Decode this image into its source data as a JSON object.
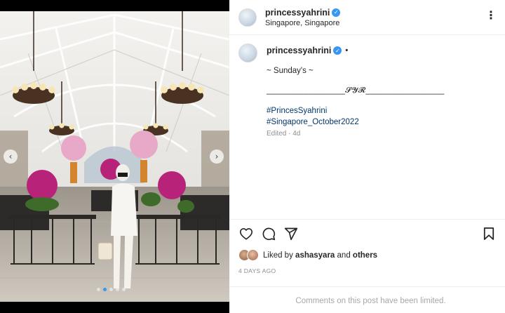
{
  "post": {
    "username": "princessyahrini",
    "location": "Singapore, Singapore",
    "more_icon": "more-horizontal-icon",
    "caption": {
      "line1": "~ Sunday's ~",
      "line2": "_________________𝓢𝓨𝓡_________________",
      "hashtags": [
        "#PrincesSyahrini",
        "#Singapore_October2022"
      ],
      "edited": "Edited · 4d"
    },
    "actions": {
      "like_icon": "heart-icon",
      "comment_icon": "comment-icon",
      "share_icon": "share-icon",
      "save_icon": "bookmark-icon"
    },
    "likes": {
      "prefix": "Liked by",
      "user": "ashasyara",
      "and": "and",
      "others": "others"
    },
    "timestamp": "4 DAYS AGO",
    "comments_limited": "Comments on this post have been limited."
  },
  "media": {
    "slide_count": 5,
    "active_slide": 1,
    "prev_icon": "chevron-left-icon",
    "next_icon": "chevron-right-icon"
  },
  "colors": {
    "verified": "#3897f0",
    "hashtag": "#00376b",
    "muted": "#8e8e8e"
  }
}
